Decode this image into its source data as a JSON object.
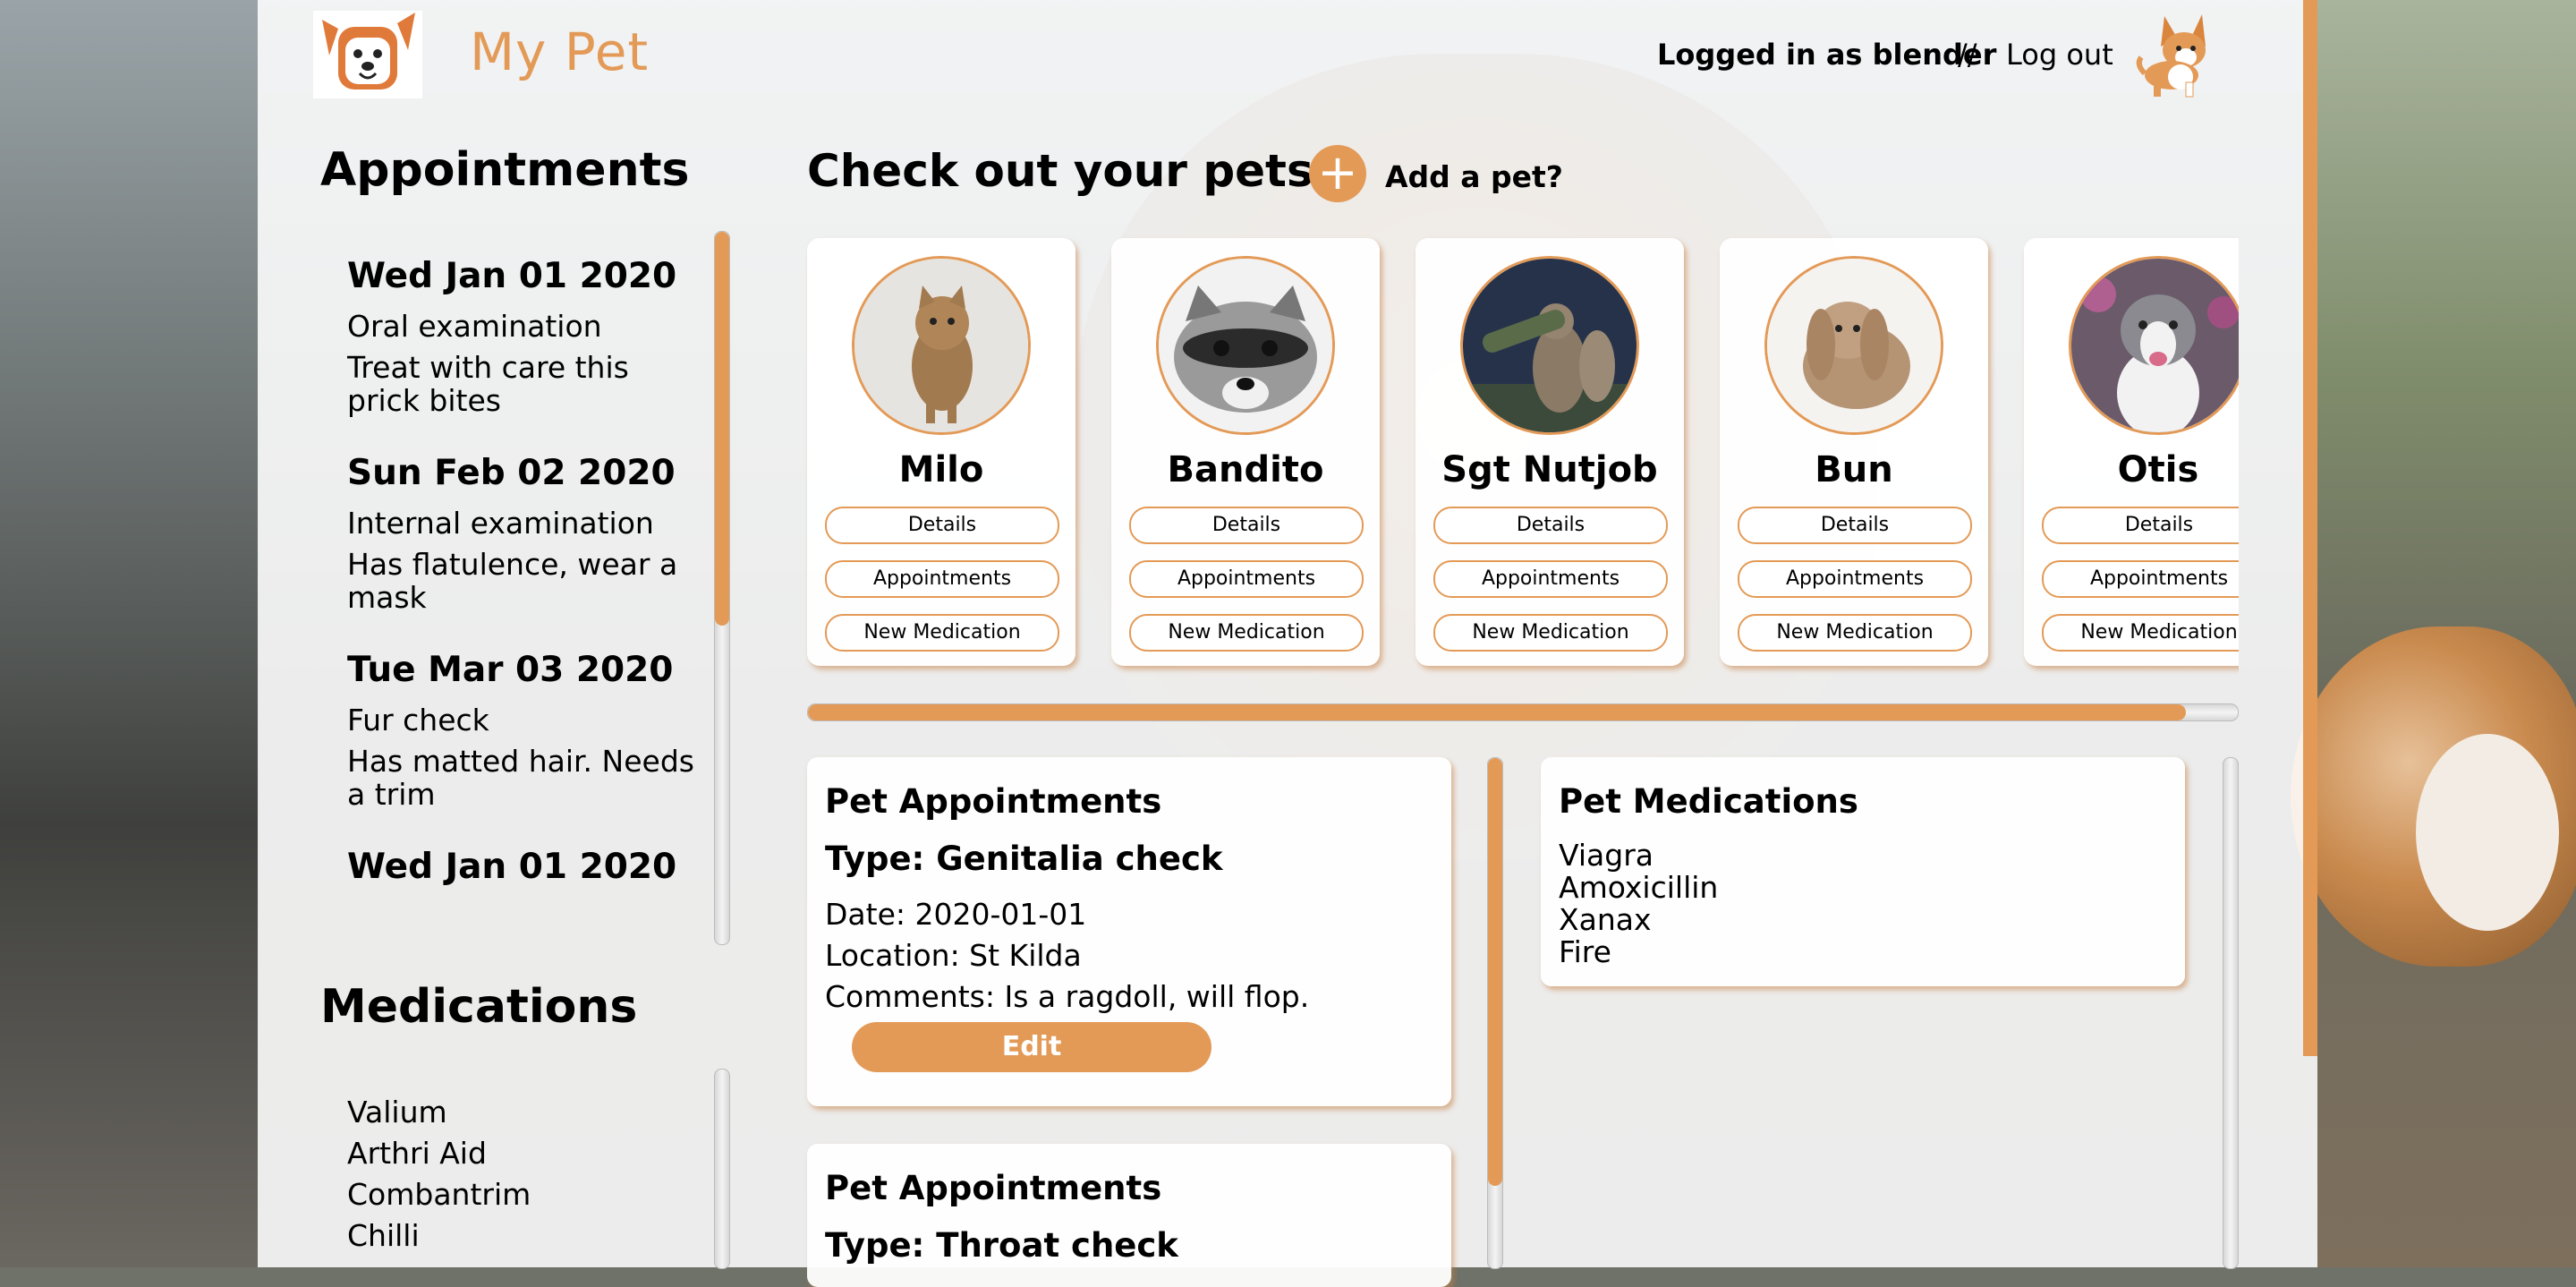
{
  "app": {
    "title": "My Pet",
    "accent_color": "#e39a57"
  },
  "header": {
    "logged_in_text": "Logged in as blender",
    "separator": "//",
    "logout_label": "Log out"
  },
  "sidebar": {
    "appointments_heading": "Appointments",
    "appointments": [
      {
        "date": "Wed Jan 01 2020",
        "type": "Oral examination",
        "comment": "Treat with care this prick bites"
      },
      {
        "date": "Sun Feb 02 2020",
        "type": "Internal examination",
        "comment": "Has flatulence, wear a mask"
      },
      {
        "date": "Tue Mar 03 2020",
        "type": "Fur check",
        "comment": "Has matted hair. Needs a trim"
      },
      {
        "date": "Wed Jan 01 2020",
        "type": "",
        "comment": ""
      }
    ],
    "medications_heading": "Medications",
    "medications": [
      "Valium",
      "Arthri Aid",
      "Combantrim",
      "Chilli"
    ]
  },
  "main": {
    "heading": "Check out your pets",
    "add_pet_label": "Add a pet?",
    "add_icon": "plus-icon",
    "pet_button_labels": {
      "details": "Details",
      "appointments": "Appointments",
      "new_medication": "New Medication"
    },
    "pets": [
      {
        "name": "Milo",
        "photo": "kitten-photo"
      },
      {
        "name": "Bandito",
        "photo": "raccoon-photo"
      },
      {
        "name": "Sgt Nutjob",
        "photo": "squirrel-photo"
      },
      {
        "name": "Bun",
        "photo": "rabbit-photo"
      },
      {
        "name": "Otis",
        "photo": "dog-photo"
      }
    ],
    "pet_appointments": [
      {
        "heading": "Pet Appointments",
        "type": "Type: Genitalia check",
        "date": "Date: 2020-01-01",
        "location": "Location: St Kilda",
        "comments": "Comments: Is a ragdoll, will flop.",
        "edit_label": "Edit"
      },
      {
        "heading": "Pet Appointments",
        "type": "Type: Throat check"
      }
    ],
    "pet_medications": {
      "heading": "Pet Medications",
      "items": [
        "Viagra",
        "Amoxicillin",
        "Xanax",
        "Fire"
      ]
    }
  }
}
